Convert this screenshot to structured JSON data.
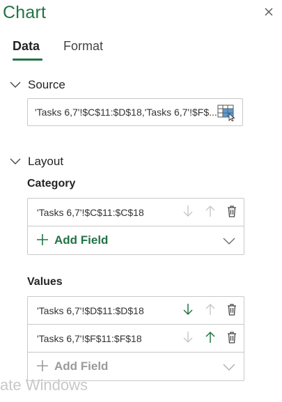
{
  "pane": {
    "title": "Chart",
    "close_icon": "close-icon"
  },
  "tabs": [
    {
      "label": "Data",
      "selected": true
    },
    {
      "label": "Format",
      "selected": false
    }
  ],
  "source": {
    "heading": "Source",
    "range_text": "'Tasks 6,7'!$C$11:$D$18,'Tasks 6,7'!$F$...",
    "icon": "select-range-icon"
  },
  "layout": {
    "heading": "Layout",
    "category": {
      "label": "Category",
      "fields": [
        {
          "text": "'Tasks 6,7'!$C$11:$C$18",
          "down_enabled": false,
          "up_enabled": false
        }
      ],
      "add_label": "Add Field",
      "add_enabled": true
    },
    "values": {
      "label": "Values",
      "fields": [
        {
          "text": "'Tasks 6,7'!$D$11:$D$18",
          "down_enabled": true,
          "up_enabled": false
        },
        {
          "text": "'Tasks 6,7'!$F$11:$F$18",
          "down_enabled": false,
          "up_enabled": true
        }
      ],
      "add_label": "Add Field",
      "add_enabled": false
    }
  },
  "overlay": {
    "watermark": "ate Windows"
  },
  "colors": {
    "accent": "#217346",
    "disabled": "#9a9a9a",
    "border": "#c8c8c8"
  }
}
